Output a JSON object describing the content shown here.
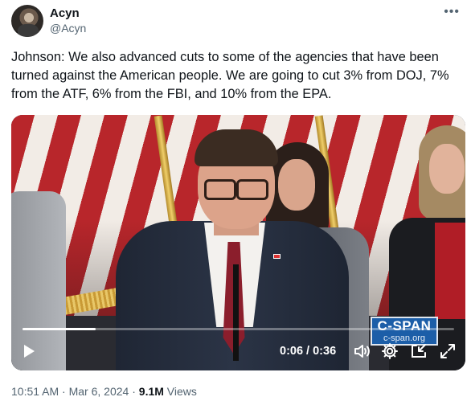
{
  "author": {
    "display_name": "Acyn",
    "handle": "@Acyn",
    "avatar_icon": "profile-photo"
  },
  "more_icon": "ellipsis-icon",
  "tweet": {
    "text": "Johnson: We also advanced cuts to some of the agencies that have been turned against the American people. We are going to cut 3% from DOJ, 7% from the ATF, 6% from the FBI, and 10% from the EPA."
  },
  "video": {
    "watermark_logo": "C-SPAN",
    "watermark_url": "c-span.org",
    "time_display": "0:06 / 0:36",
    "progress": 0.17,
    "controls": [
      "play-icon",
      "volume-icon",
      "settings-gear-icon",
      "dock-icon",
      "fullscreen-icon"
    ],
    "colors": {
      "cspan_blue": "#1c5ea8"
    }
  },
  "footer": {
    "time": "10:51 AM",
    "separator": "·",
    "date": "Mar 6, 2024",
    "views_count": "9.1M",
    "views_label": "Views"
  }
}
